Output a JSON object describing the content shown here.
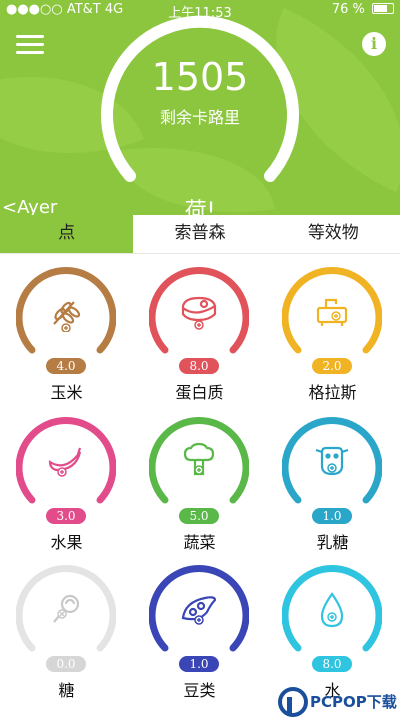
{
  "status": {
    "carrier": "●●●○○ AT&T 4G",
    "time": "上午11:53",
    "battery": "76 %"
  },
  "summary": {
    "calories_remaining": "1505",
    "calories_label": "剩余卡路里",
    "greeting": "荷!",
    "prev_day": "<Ayer"
  },
  "tabs": [
    {
      "label": "点",
      "active": true
    },
    {
      "label": "索普森",
      "active": false
    },
    {
      "label": "等效物",
      "active": false
    }
  ],
  "foods": [
    {
      "name": "玉米",
      "value": "4.0",
      "color": "#b57c43",
      "icon": "wheat-icon"
    },
    {
      "name": "蛋白质",
      "value": "8.0",
      "color": "#e0535a",
      "icon": "meat-icon"
    },
    {
      "name": "格拉斯",
      "value": "2.0",
      "color": "#f0b323",
      "icon": "oil-icon"
    },
    {
      "name": "水果",
      "value": "3.0",
      "color": "#e34c8b",
      "icon": "banana-icon"
    },
    {
      "name": "蔬菜",
      "value": "5.0",
      "color": "#59b848",
      "icon": "broccoli-icon"
    },
    {
      "name": "乳糖",
      "value": "1.0",
      "color": "#2aa6c9",
      "icon": "cow-icon"
    },
    {
      "name": "糖",
      "value": "0.0",
      "color": "#c8c8c8",
      "icon": "candy-icon"
    },
    {
      "name": "豆类",
      "value": "1.0",
      "color": "#3a46b6",
      "icon": "bean-icon"
    },
    {
      "name": "水",
      "value": "8.0",
      "color": "#2fc4e0",
      "icon": "water-drop-icon"
    }
  ],
  "watermark": "PCPOP下载"
}
